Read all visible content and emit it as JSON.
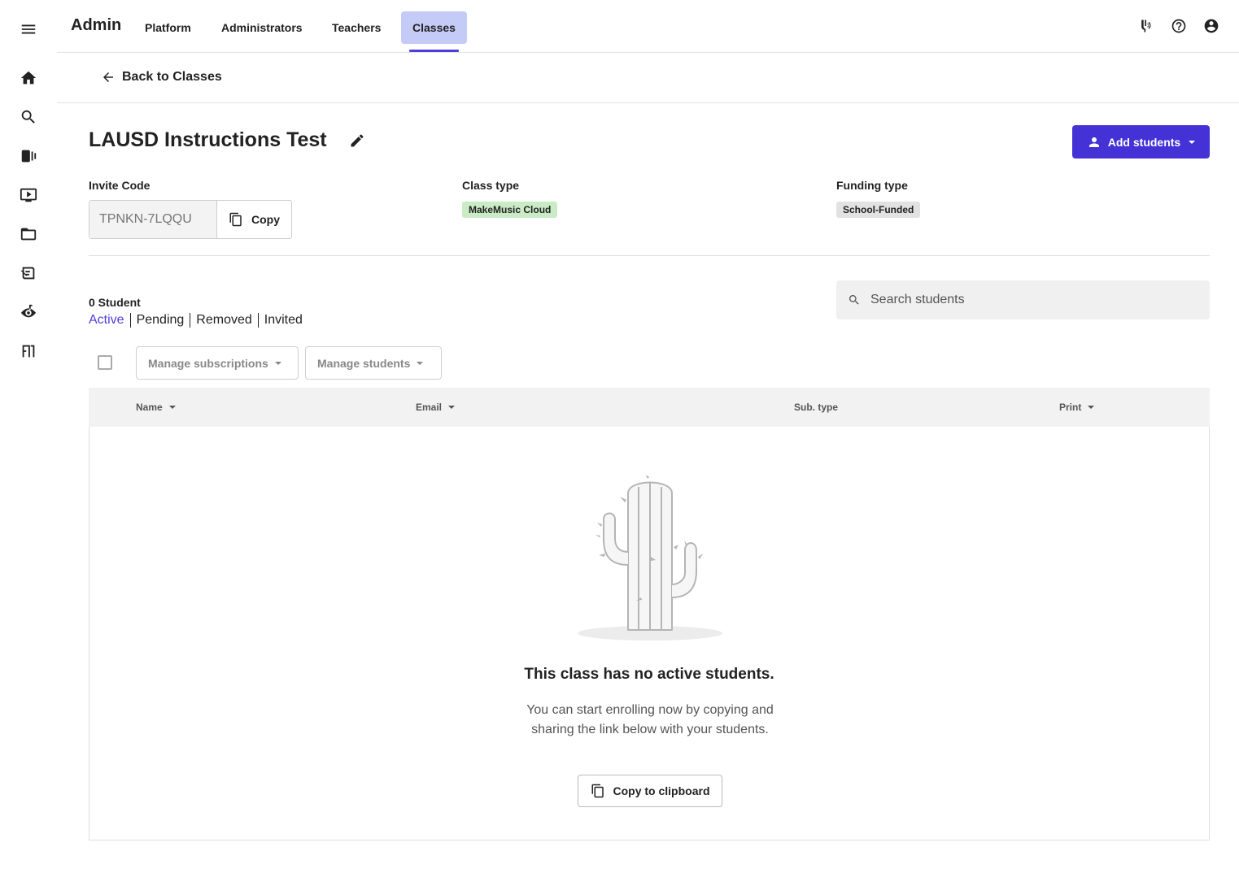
{
  "rail": {
    "items": [
      {
        "icon": "menu-icon"
      },
      {
        "icon": "home-icon"
      },
      {
        "icon": "search-icon"
      },
      {
        "icon": "library-icon"
      },
      {
        "icon": "video-icon"
      },
      {
        "icon": "folder-icon"
      },
      {
        "icon": "assignments-icon"
      },
      {
        "icon": "eye-music-icon"
      },
      {
        "icon": "exit-icon"
      }
    ]
  },
  "header": {
    "brand": "Admin",
    "tabs": [
      {
        "label": "Platform"
      },
      {
        "label": "Administrators"
      },
      {
        "label": "Teachers"
      },
      {
        "label": "Classes",
        "active": true
      }
    ],
    "right_icons": [
      "tuner-icon",
      "help-icon",
      "account-icon"
    ]
  },
  "back": {
    "label": "Back to Classes"
  },
  "class": {
    "title": "LAUSD Instructions Test",
    "add_students_label": "Add students",
    "invite_label": "Invite Code",
    "invite_code": "TPNKN-7LQQU",
    "copy_label": "Copy",
    "class_type_label": "Class type",
    "class_type": "MakeMusic Cloud",
    "funding_type_label": "Funding type",
    "funding_type": "School-Funded"
  },
  "students": {
    "count_label": "0 Student",
    "filters": [
      {
        "label": "Active",
        "active": true
      },
      {
        "label": "Pending"
      },
      {
        "label": "Removed"
      },
      {
        "label": "Invited"
      }
    ],
    "search_placeholder": "Search students",
    "manage_subscriptions_label": "Manage subscriptions",
    "manage_students_label": "Manage students",
    "columns": [
      {
        "label": "Name",
        "sortable": true
      },
      {
        "label": "Email",
        "sortable": true
      },
      {
        "label": "Sub. type",
        "sortable": false
      },
      {
        "label": "Print",
        "sortable": true
      }
    ]
  },
  "empty_state": {
    "title": "This class has no active students.",
    "text": "You can start enrolling now by copying and sharing the link below with your students.",
    "button_label": "Copy to clipboard"
  },
  "colors": {
    "accent": "#4432d6",
    "active_tab_bg": "#c5cbf7",
    "class_type_badge": "#c9ecc6",
    "funding_badge": "#e2e2e2"
  }
}
